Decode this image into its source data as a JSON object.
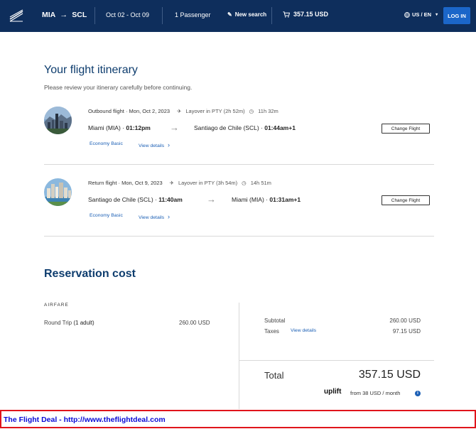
{
  "header": {
    "origin": "MIA",
    "destination": "SCL",
    "dates": "Oct 02 - Oct 09",
    "passengers": "1 Passenger",
    "new_search": "New search",
    "cart_total": "357.15 USD",
    "language": "US / EN",
    "login": "LOG IN",
    "colors": {
      "header_bg": "#0e2e5c",
      "login_bg": "#1b66c9"
    }
  },
  "itinerary": {
    "title": "Your flight itinerary",
    "subtitle": "Please review your itinerary carefully before continuing.",
    "flights": [
      {
        "heading": "Outbound flight · Mon, Oct 2, 2023",
        "layover": "Layover in PTY (2h 52m)",
        "duration": "11h 32m",
        "from": "Miami (MIA) · ",
        "from_time": "01:12pm",
        "to": "Santiago de Chile (SCL) · ",
        "to_time": "01:44am+1",
        "fare": "Economy Basic",
        "details": "View details",
        "change": "Change Flight"
      },
      {
        "heading": "Return flight · Mon, Oct 9, 2023",
        "layover": "Layover in PTY (3h 54m)",
        "duration": "14h 51m",
        "from": "Santiago de Chile (SCL) · ",
        "from_time": "11:40am",
        "to": "Miami (MIA) · ",
        "to_time": "01:31am+1",
        "fare": "Economy Basic",
        "details": "View details",
        "change": "Change Flight"
      }
    ]
  },
  "reservation": {
    "title": "Reservation cost",
    "airfare_label": "AIRFARE",
    "round_trip": "Round Trip",
    "adults": "(1 adult)",
    "round_trip_value": "260.00 USD",
    "subtotal_label": "Subtotal",
    "subtotal_value": "260.00 USD",
    "taxes_label": "Taxes",
    "taxes_link": "View details",
    "taxes_value": "97.15 USD",
    "total_label": "Total",
    "total_value": "357.15 USD",
    "uplift_logo": "uplift",
    "uplift_text": "from 38 USD  / month",
    "info_glyph": "i"
  },
  "banner": {
    "text": "The Flight Deal - http://www.theflightdeal.com"
  },
  "icons": {
    "plane": "✈",
    "clock": "◷",
    "arrow": "→",
    "chevron": "›",
    "pencil": "✎"
  }
}
